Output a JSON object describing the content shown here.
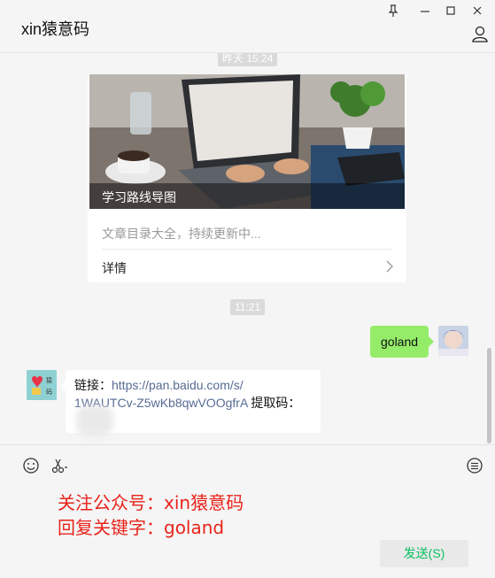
{
  "window": {
    "title": "xin猿意码",
    "controls": [
      "pin-icon",
      "minimize-icon",
      "maximize-icon",
      "close-icon"
    ]
  },
  "messages": {
    "top_time": "昨天 15:24",
    "article": {
      "title": "学习路线导图",
      "description": "文章目录大全，持续更新中...",
      "detail_label": "详情"
    },
    "time_divider": "11:21",
    "sent_message": "goland",
    "received": {
      "prefix": "链接：",
      "link_part1": "https://pan.baidu.com/s/",
      "link_part2": "1WAUTCv-Z5wKb8qwVOOgfrA",
      "suffix": " 提取码："
    },
    "other_avatar_text": "猿 码"
  },
  "composer": {
    "tools": [
      "emoji-icon",
      "scissors-icon",
      "chat-history-icon"
    ],
    "draft_line1": "关注公众号：xin猿意码",
    "draft_line2": "回复关键字：goland",
    "send_label": "发送(S)"
  },
  "colors": {
    "sent_bubble": "#95ec69",
    "link": "#576b95",
    "draft_text": "#e8231b",
    "send_text": "#07c160"
  }
}
